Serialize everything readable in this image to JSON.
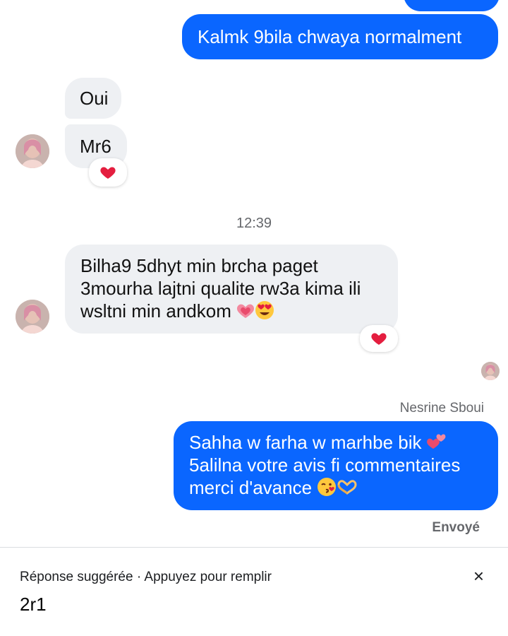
{
  "conversation": {
    "messages": [
      {
        "id": "out-1",
        "text": "Kalmk 9bila chwaya normalment",
        "direction": "outgoing"
      },
      {
        "id": "in-1",
        "text": "Oui",
        "direction": "incoming"
      },
      {
        "id": "in-2",
        "text": "Mr6",
        "direction": "incoming",
        "reaction": "red-heart"
      },
      {
        "id": "in-3",
        "lines": [
          "Bilha9 5dhyt min brcha paget",
          "3mourha lajtni qualite rw3a kima ili",
          "wsltni min andkom"
        ],
        "emojis": [
          "sparkling-heart",
          "heart-eyes"
        ],
        "reaction": "red-heart"
      },
      {
        "id": "out-2",
        "lines": [
          "Sahha w farha w marhbe bik",
          "5alilna votre avis fi commentaires",
          "merci d'avance"
        ],
        "emojis_line1": [
          "two-hearts"
        ],
        "emojis_line3": [
          "kissing-face",
          "heart-hands"
        ]
      }
    ],
    "timestamp": "12:39",
    "sender_name": "Nesrine Sboui",
    "status": "Envoyé"
  },
  "suggestion": {
    "label": "Réponse suggérée · Appuyez pour remplir",
    "text": "2r1",
    "close_symbol": "×"
  },
  "colors": {
    "outgoing_bubble": "#0a66ff",
    "incoming_bubble": "#eef0f3",
    "reaction_heart": "#e41e3f"
  }
}
